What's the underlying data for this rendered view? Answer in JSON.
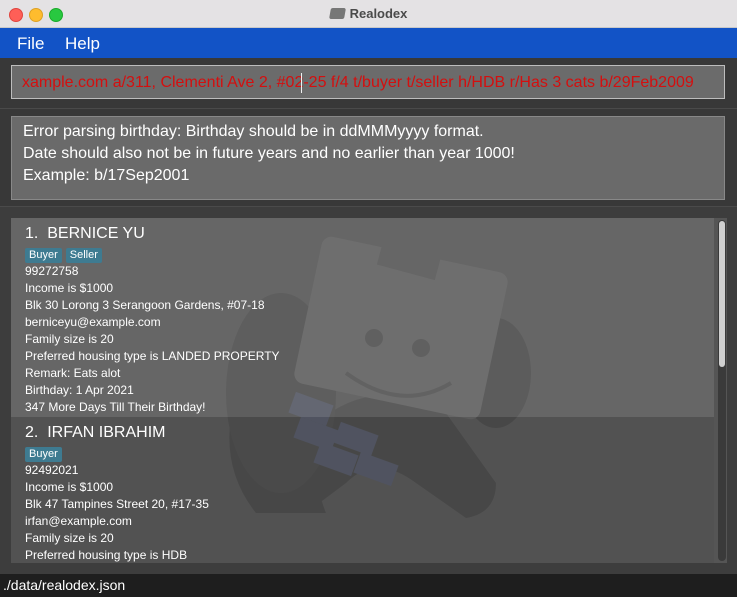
{
  "window": {
    "title": "Realodex",
    "app_icon": "rolodex-icon"
  },
  "menu": {
    "file": "File",
    "help": "Help"
  },
  "command": {
    "value": "xample.com a/311, Clementi Ave 2, #02-25 f/4 t/buyer t/seller h/HDB r/Has 3 cats b/29Feb2009",
    "text_color": "#d40f0f"
  },
  "result": {
    "lines": [
      "Error parsing birthday: Birthday should be in ddMMMyyyy format.",
      "Date should also not be in future years and no earlier than year 1000!",
      "Example: b/17Sep2001"
    ]
  },
  "clients": [
    {
      "index": "1.",
      "name": "BERNICE YU",
      "tags": [
        "Buyer",
        "Seller"
      ],
      "phone": "99272758",
      "income": "Income is $1000",
      "address": "Blk 30 Lorong 3 Serangoon Gardens, #07-18",
      "email": "berniceyu@example.com",
      "family": "Family size is 20",
      "housing": "Preferred housing type is LANDED PROPERTY",
      "remark": "Remark: Eats alot",
      "birthday": "Birthday: 1 Apr 2021",
      "countdown": "347 More Days Till Their Birthday!"
    },
    {
      "index": "2.",
      "name": "IRFAN IBRAHIM",
      "tags": [
        "Buyer"
      ],
      "phone": "92492021",
      "income": "Income is $1000",
      "address": "Blk 47 Tampines Street 20, #17-35",
      "email": "irfan@example.com",
      "family": "Family size is 20",
      "housing": "Preferred housing type is HDB"
    }
  ],
  "status": {
    "path": "./data/realodex.json"
  },
  "colors": {
    "menubar": "#1253c6",
    "tag": "#3e7b91",
    "error_text": "#d40f0f"
  }
}
